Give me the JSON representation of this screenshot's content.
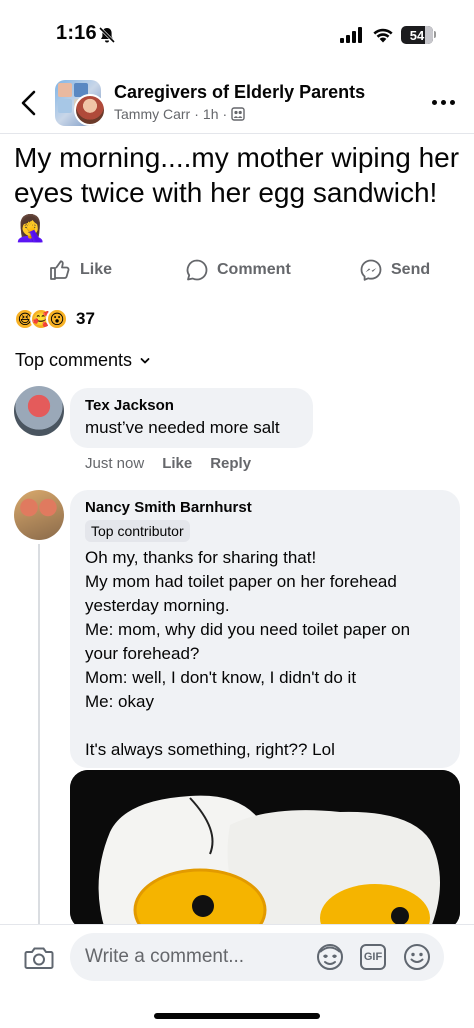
{
  "status_bar": {
    "time": "1:16",
    "battery": "54"
  },
  "header": {
    "group_name": "Caregivers of Elderly Parents",
    "poster_name": "Tammy Carr",
    "time_ago": "1h",
    "separator": "·"
  },
  "post": {
    "text": "My morning....my mother wiping her eyes twice with her egg sandwich!",
    "trailing_emoji": "🤦‍♀️"
  },
  "actions": {
    "like_label": "Like",
    "comment_label": "Comment",
    "send_label": "Send"
  },
  "reactions": {
    "count": "37",
    "icons": [
      "haha",
      "care",
      "wow"
    ]
  },
  "comments_header": {
    "label": "Top comments"
  },
  "comments": [
    {
      "author": "Tex Jackson",
      "text": "must’ve needed more salt",
      "time": "Just now",
      "like_label": "Like",
      "reply_label": "Reply"
    },
    {
      "author": "Nancy Smith Barnhurst",
      "badge": "Top contributor",
      "lines": [
        "Oh my, thanks for sharing that!",
        "My mom had toilet paper on her forehead yesterday morning.",
        "Me:  mom, why did you need toilet paper on your forehead?",
        "Mom:  well, I don't know, I didn't do it",
        "Me:  okay",
        "",
        "It's always something, right??  Lol"
      ]
    }
  ],
  "composer": {
    "placeholder": "Write a comment...",
    "gif_label": "GIF"
  },
  "colors": {
    "secondary_text": "#65676b",
    "bubble": "#f0f2f5",
    "egg_yolk": "#f5b400"
  }
}
